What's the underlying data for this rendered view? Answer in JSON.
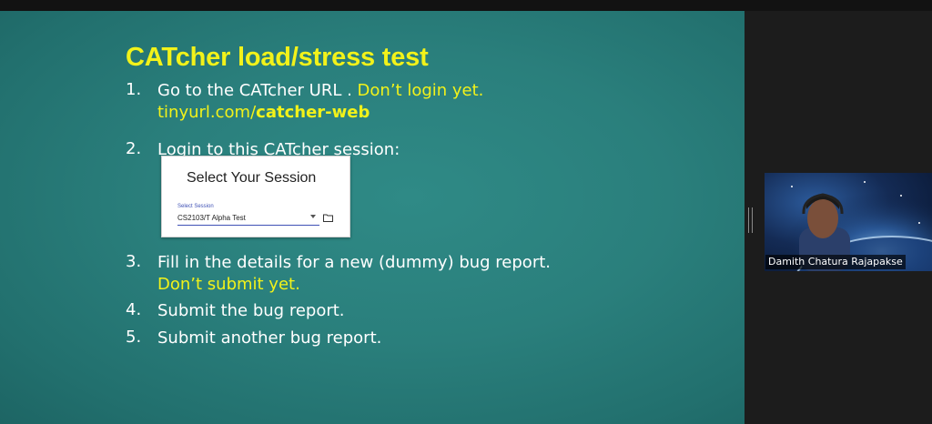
{
  "slide": {
    "title": "CATcher load/stress test",
    "items": [
      {
        "num": "1.",
        "line1_a": "Go to the CATcher URL . ",
        "line1_b": "Don’t login yet.",
        "line2_a": "tinyurl.com/",
        "line2_b": "catcher-web"
      },
      {
        "num": "2.",
        "line1_a": "Login to this CATcher session:"
      },
      {
        "num": "3.",
        "line1_a": "Fill in the details for a new (dummy) bug report.",
        "line2_a": "Don’t submit yet."
      },
      {
        "num": "4.",
        "line1_a": "Submit the bug report."
      },
      {
        "num": "5.",
        "line1_a": "Submit another bug report."
      }
    ],
    "session_card": {
      "title": "Select Your Session",
      "field_label": "Select Session",
      "field_value": "CS2103/T Alpha Test"
    }
  },
  "participant": {
    "name": "Damith Chatura Rajapakse"
  },
  "colors": {
    "slide_bg": "#2a7f7c",
    "highlight": "#f2f21a",
    "text": "#ffffff"
  }
}
